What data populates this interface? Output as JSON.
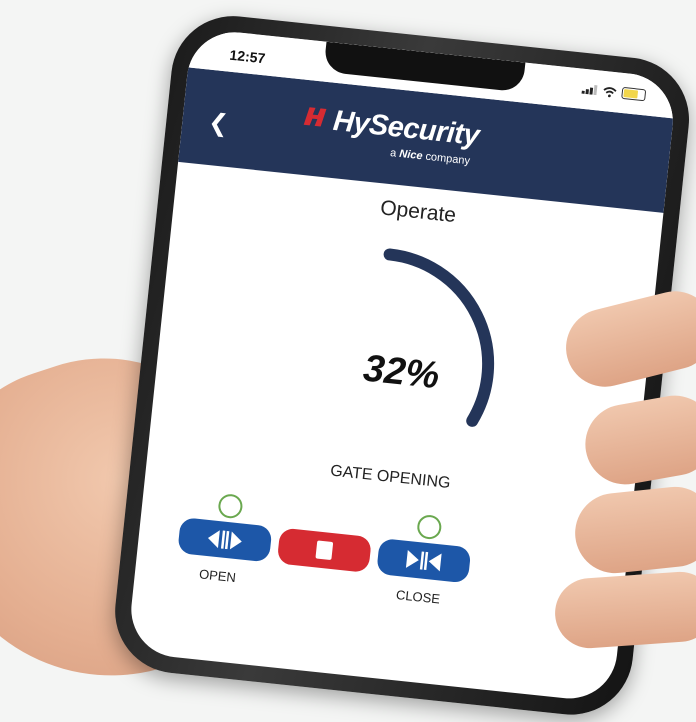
{
  "status_bar": {
    "time": "12:57"
  },
  "header": {
    "brand": "HySecurity",
    "tagline_prefix": "a",
    "tagline_brand": "Nice",
    "tagline_suffix": "company"
  },
  "page": {
    "title": "Operate",
    "progress_percent_label": "32%",
    "progress_fraction": 0.32,
    "state_text": "GATE OPENING"
  },
  "controls": {
    "open_label": "OPEN",
    "close_label": "CLOSE"
  },
  "colors": {
    "header_bg": "#243559",
    "gauge_arc": "#243559",
    "open_close_button": "#1d57a8",
    "stop_button": "#d62b32",
    "indicator_ring": "#6aa84f"
  },
  "icons": {
    "back": "chevron-left-icon",
    "open": "open-arrows-icon",
    "stop": "stop-square-icon",
    "close": "close-arrows-icon"
  }
}
